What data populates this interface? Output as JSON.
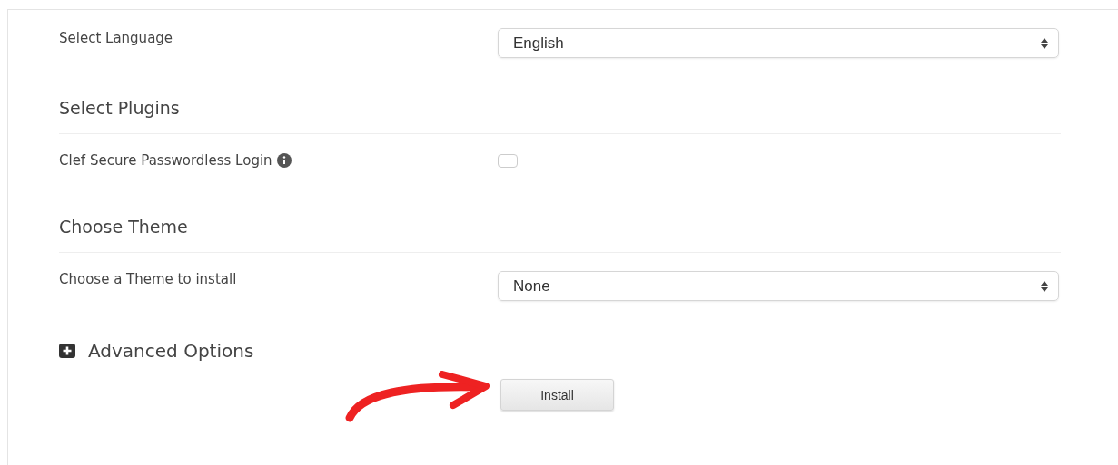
{
  "language": {
    "label": "Select Language",
    "value": "English"
  },
  "plugins": {
    "heading": "Select Plugins",
    "items": [
      {
        "label": "Clef Secure Passwordless Login",
        "checked": false
      }
    ]
  },
  "theme": {
    "heading": "Choose Theme",
    "label": "Choose a Theme to install",
    "value": "None"
  },
  "advanced": {
    "label": "Advanced Options",
    "expanded": false
  },
  "install_button": "Install"
}
